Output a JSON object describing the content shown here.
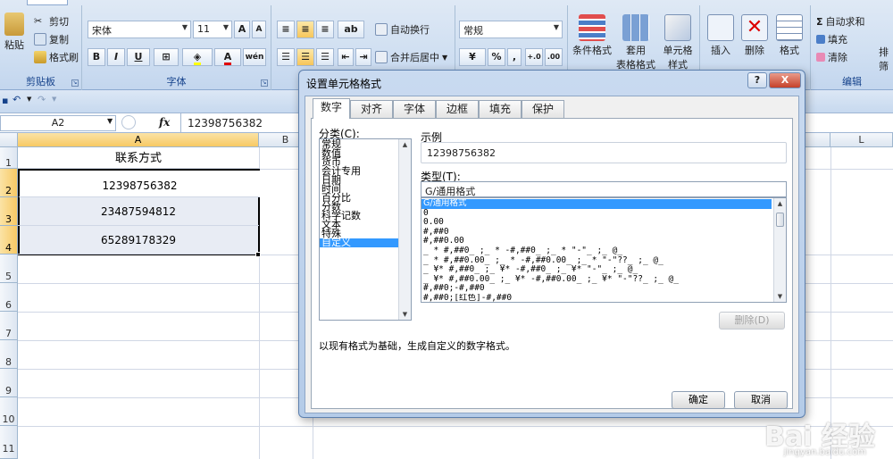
{
  "ribbon": {
    "clipboard": {
      "paste": "粘贴",
      "cut": "剪切",
      "copy": "复制",
      "format_painter": "格式刷",
      "label": "剪贴板"
    },
    "font": {
      "name": "宋体",
      "size": "11",
      "bold": "B",
      "italic": "I",
      "underline": "U",
      "label": "字体",
      "grow": "A",
      "shrink": "A",
      "wen": "wén"
    },
    "alignment": {
      "wrap": "自动换行",
      "merge": "合并后居中"
    },
    "number": {
      "format": "常规",
      "percent": "%",
      "comma": ",",
      "inc": "+.0",
      "dec": ".00"
    },
    "styles": {
      "conditional": "条件格式",
      "table": "套用",
      "table2": "表格格式",
      "cell": "单元格",
      "cell2": "样式"
    },
    "cells": {
      "insert": "插入",
      "delete": "删除",
      "format": "格式"
    },
    "editing": {
      "autosum": "自动求和",
      "fill": "填充",
      "clear": "清除",
      "label": "编辑",
      "sort": "排",
      "sort2": "筛"
    }
  },
  "formula_bar": {
    "name_box": "A2",
    "fx": "fx",
    "value": "12398756382"
  },
  "sheet": {
    "columns": [
      "A",
      "B",
      "L"
    ],
    "rows": [
      "1",
      "2",
      "3",
      "4",
      "5",
      "6",
      "7",
      "8",
      "9",
      "10",
      "11"
    ],
    "cells": {
      "A1": "联系方式",
      "A2": "12398756382",
      "A3": "23487594812",
      "A4": "65289178329"
    }
  },
  "dialog": {
    "title": "设置单元格格式",
    "help": "?",
    "close": "X",
    "tabs": [
      "数字",
      "对齐",
      "字体",
      "边框",
      "填充",
      "保护"
    ],
    "category_label": "分类(C):",
    "categories": [
      "常规",
      "数值",
      "货币",
      "会计专用",
      "日期",
      "时间",
      "百分比",
      "分数",
      "科学记数",
      "文本",
      "特殊",
      "自定义"
    ],
    "selected_category": "自定义",
    "sample_label": "示例",
    "sample_value": "12398756382",
    "type_label": "类型(T):",
    "type_value": "G/通用格式",
    "type_list": [
      "G/通用格式",
      "0",
      "0.00",
      "#,##0",
      "#,##0.00",
      "_ * #,##0_ ;_ * -#,##0_ ;_ * \"-\"_ ;_ @_",
      "_ * #,##0.00_ ;_ * -#,##0.00_ ;_ * \"-\"??_ ;_ @_",
      "_ ¥* #,##0_ ;_ ¥* -#,##0_ ;_ ¥* \"-\"_ ;_ @_",
      "_ ¥* #,##0.00_ ;_ ¥* -#,##0.00_ ;_ ¥* \"-\"??_ ;_ @_",
      "#,##0;-#,##0",
      "#,##0;[红色]-#,##0"
    ],
    "delete_button": "删除(D)",
    "description": "以现有格式为基础，生成自定义的数字格式。",
    "ok": "确定",
    "cancel": "取消"
  },
  "watermark": {
    "main": "Bai 经验",
    "sub": "jingyan.baidu.com"
  }
}
